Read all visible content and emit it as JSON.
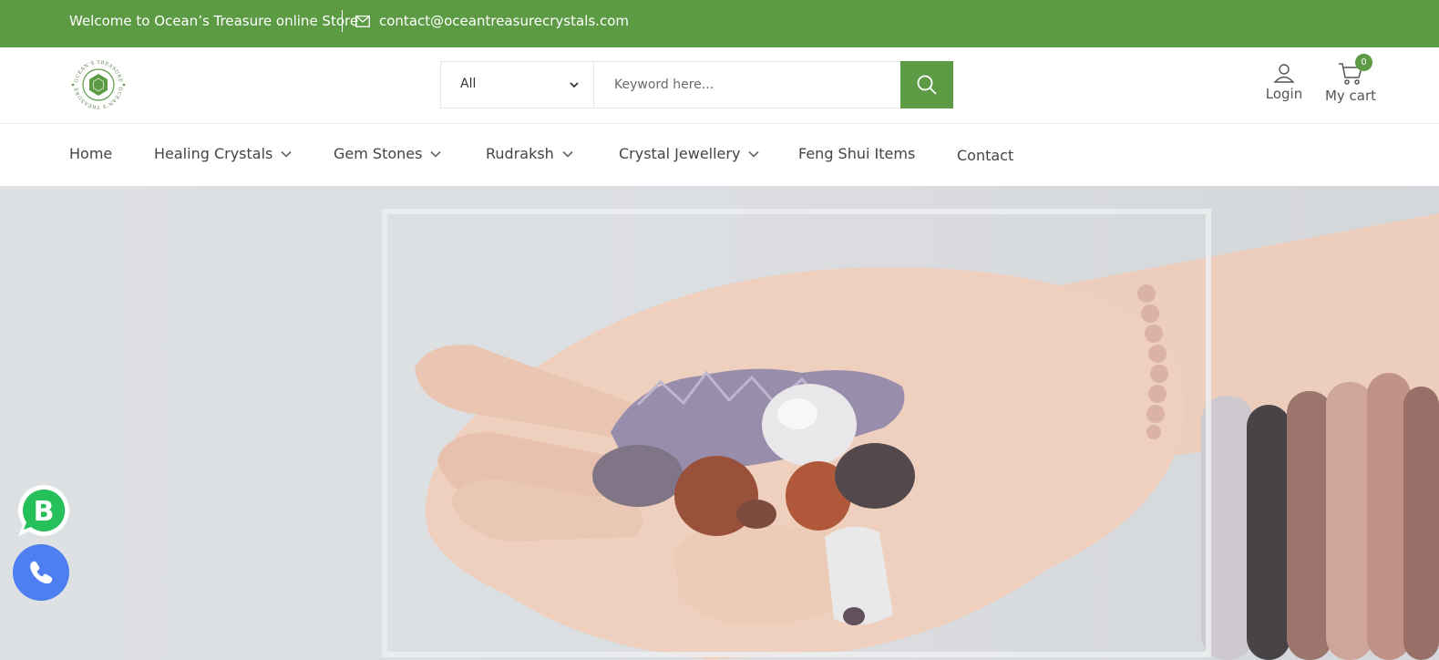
{
  "topbar": {
    "welcome": "Welcome to Ocean’s Treasure online Store",
    "email": "contact@oceantreasurecrystals.com",
    "mail_icon": "mail-icon"
  },
  "brand": {
    "logo_text": "OCEAN’S TREASURE",
    "accent_color": "#5c9a44"
  },
  "search": {
    "category": "All",
    "placeholder": "Keyword here...",
    "button_icon": "search-icon"
  },
  "account": {
    "login_label": "Login",
    "cart_label": "My cart",
    "cart_count": "0"
  },
  "nav": {
    "items": [
      {
        "label": "Home",
        "has_dropdown": false
      },
      {
        "label": "Healing Crystals",
        "has_dropdown": true
      },
      {
        "label": "Gem Stones",
        "has_dropdown": true
      },
      {
        "label": "Rudraksh",
        "has_dropdown": true
      },
      {
        "label": "Crystal Jewellery",
        "has_dropdown": true
      },
      {
        "label": "Feng Shui Items",
        "has_dropdown": false
      },
      {
        "label": "Contact",
        "has_dropdown": false
      }
    ]
  },
  "floating": {
    "whatsapp_icon": "whatsapp-business-icon",
    "whatsapp_letter": "B",
    "phone_icon": "phone-icon",
    "phone_color": "#4e7ff0"
  }
}
